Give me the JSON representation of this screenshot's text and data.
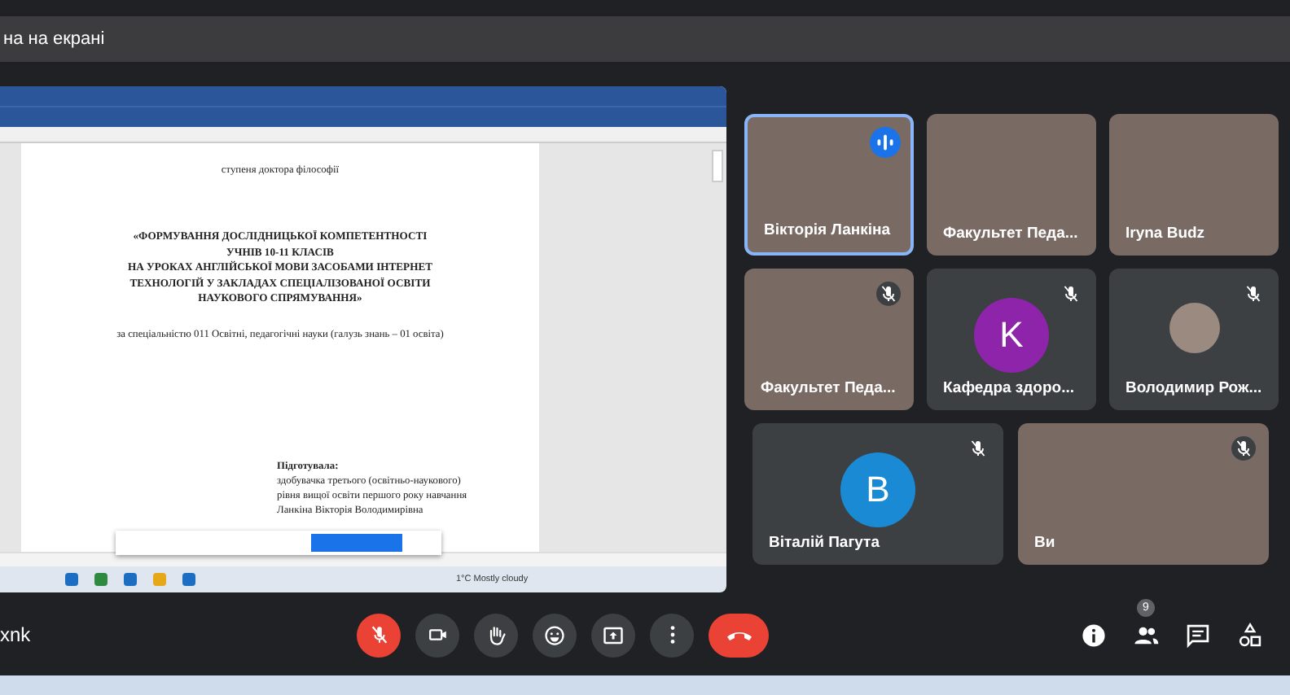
{
  "top_bar": {
    "text": "на на екрані"
  },
  "shared_screen": {
    "document_lines": [
      {
        "text": "ступеня доктора філософії",
        "kind": "center"
      },
      {
        "text": "«ФОРМУВАННЯ ДОСЛІДНИЦЬКОЇ КОМПЕТЕНТНОСТІ",
        "kind": "title"
      },
      {
        "text": "УЧНІВ 10-11 КЛАСІВ",
        "kind": "title"
      },
      {
        "text": "НА УРОКАХ АНГЛІЙСЬКОЇ МОВИ ЗАСОБАМИ ІНТЕРНЕТ",
        "kind": "title"
      },
      {
        "text": "ТЕХНОЛОГІЙ У ЗАКЛАДАХ СПЕЦІАЛІЗОВАНОЇ ОСВІТИ",
        "kind": "title"
      },
      {
        "text": "НАУКОВОГО СПРЯМУВАННЯ»",
        "kind": "title"
      },
      {
        "text": "за спеціальністю 011 Освітні, педагогічні науки  (галузь знань – 01 освіта)",
        "kind": "center"
      },
      {
        "text": "Підготувала:",
        "kind": "label"
      },
      {
        "text": "здобувачка третього (освітньо-наукового)",
        "kind": "right"
      },
      {
        "text": "рівня вищої освіти першого року навчання",
        "kind": "right"
      },
      {
        "text": "Ланкіна Вікторія Володимирівна",
        "kind": "right"
      }
    ],
    "weather": "1°C  Mostly cloudy"
  },
  "tile_rows": [
    [
      {
        "name": "Вікторія Ланкіна",
        "kind": "video",
        "muted": false,
        "speaking": true
      },
      {
        "name": "Факультет Педа...",
        "kind": "video",
        "muted": false,
        "speaking": false
      },
      {
        "name": "Iryna Budz",
        "kind": "video",
        "muted": false,
        "speaking": false
      }
    ],
    [
      {
        "name": "Факультет Педа...",
        "kind": "video",
        "muted": true,
        "speaking": false
      },
      {
        "name": "Кафедра здоро...",
        "kind": "avatar",
        "letter": "K",
        "color": "#8e24aa",
        "muted": true,
        "speaking": false
      },
      {
        "name": "Володимир Рож...",
        "kind": "photo",
        "muted": true,
        "speaking": false
      }
    ],
    [
      {
        "name": "Віталій Пагута",
        "kind": "avatar",
        "letter": "B",
        "color": "#1a8ad4",
        "muted": true,
        "speaking": false
      },
      {
        "name": "Ви",
        "kind": "video",
        "muted": true,
        "speaking": false
      }
    ]
  ],
  "user_label": "xnk",
  "mic_muted": true,
  "controls": [
    {
      "kind": "camera"
    },
    {
      "kind": "hand"
    },
    {
      "kind": "emoji"
    },
    {
      "kind": "present"
    },
    {
      "kind": "more"
    },
    {
      "kind": "hangup"
    }
  ],
  "people_count": "9"
}
